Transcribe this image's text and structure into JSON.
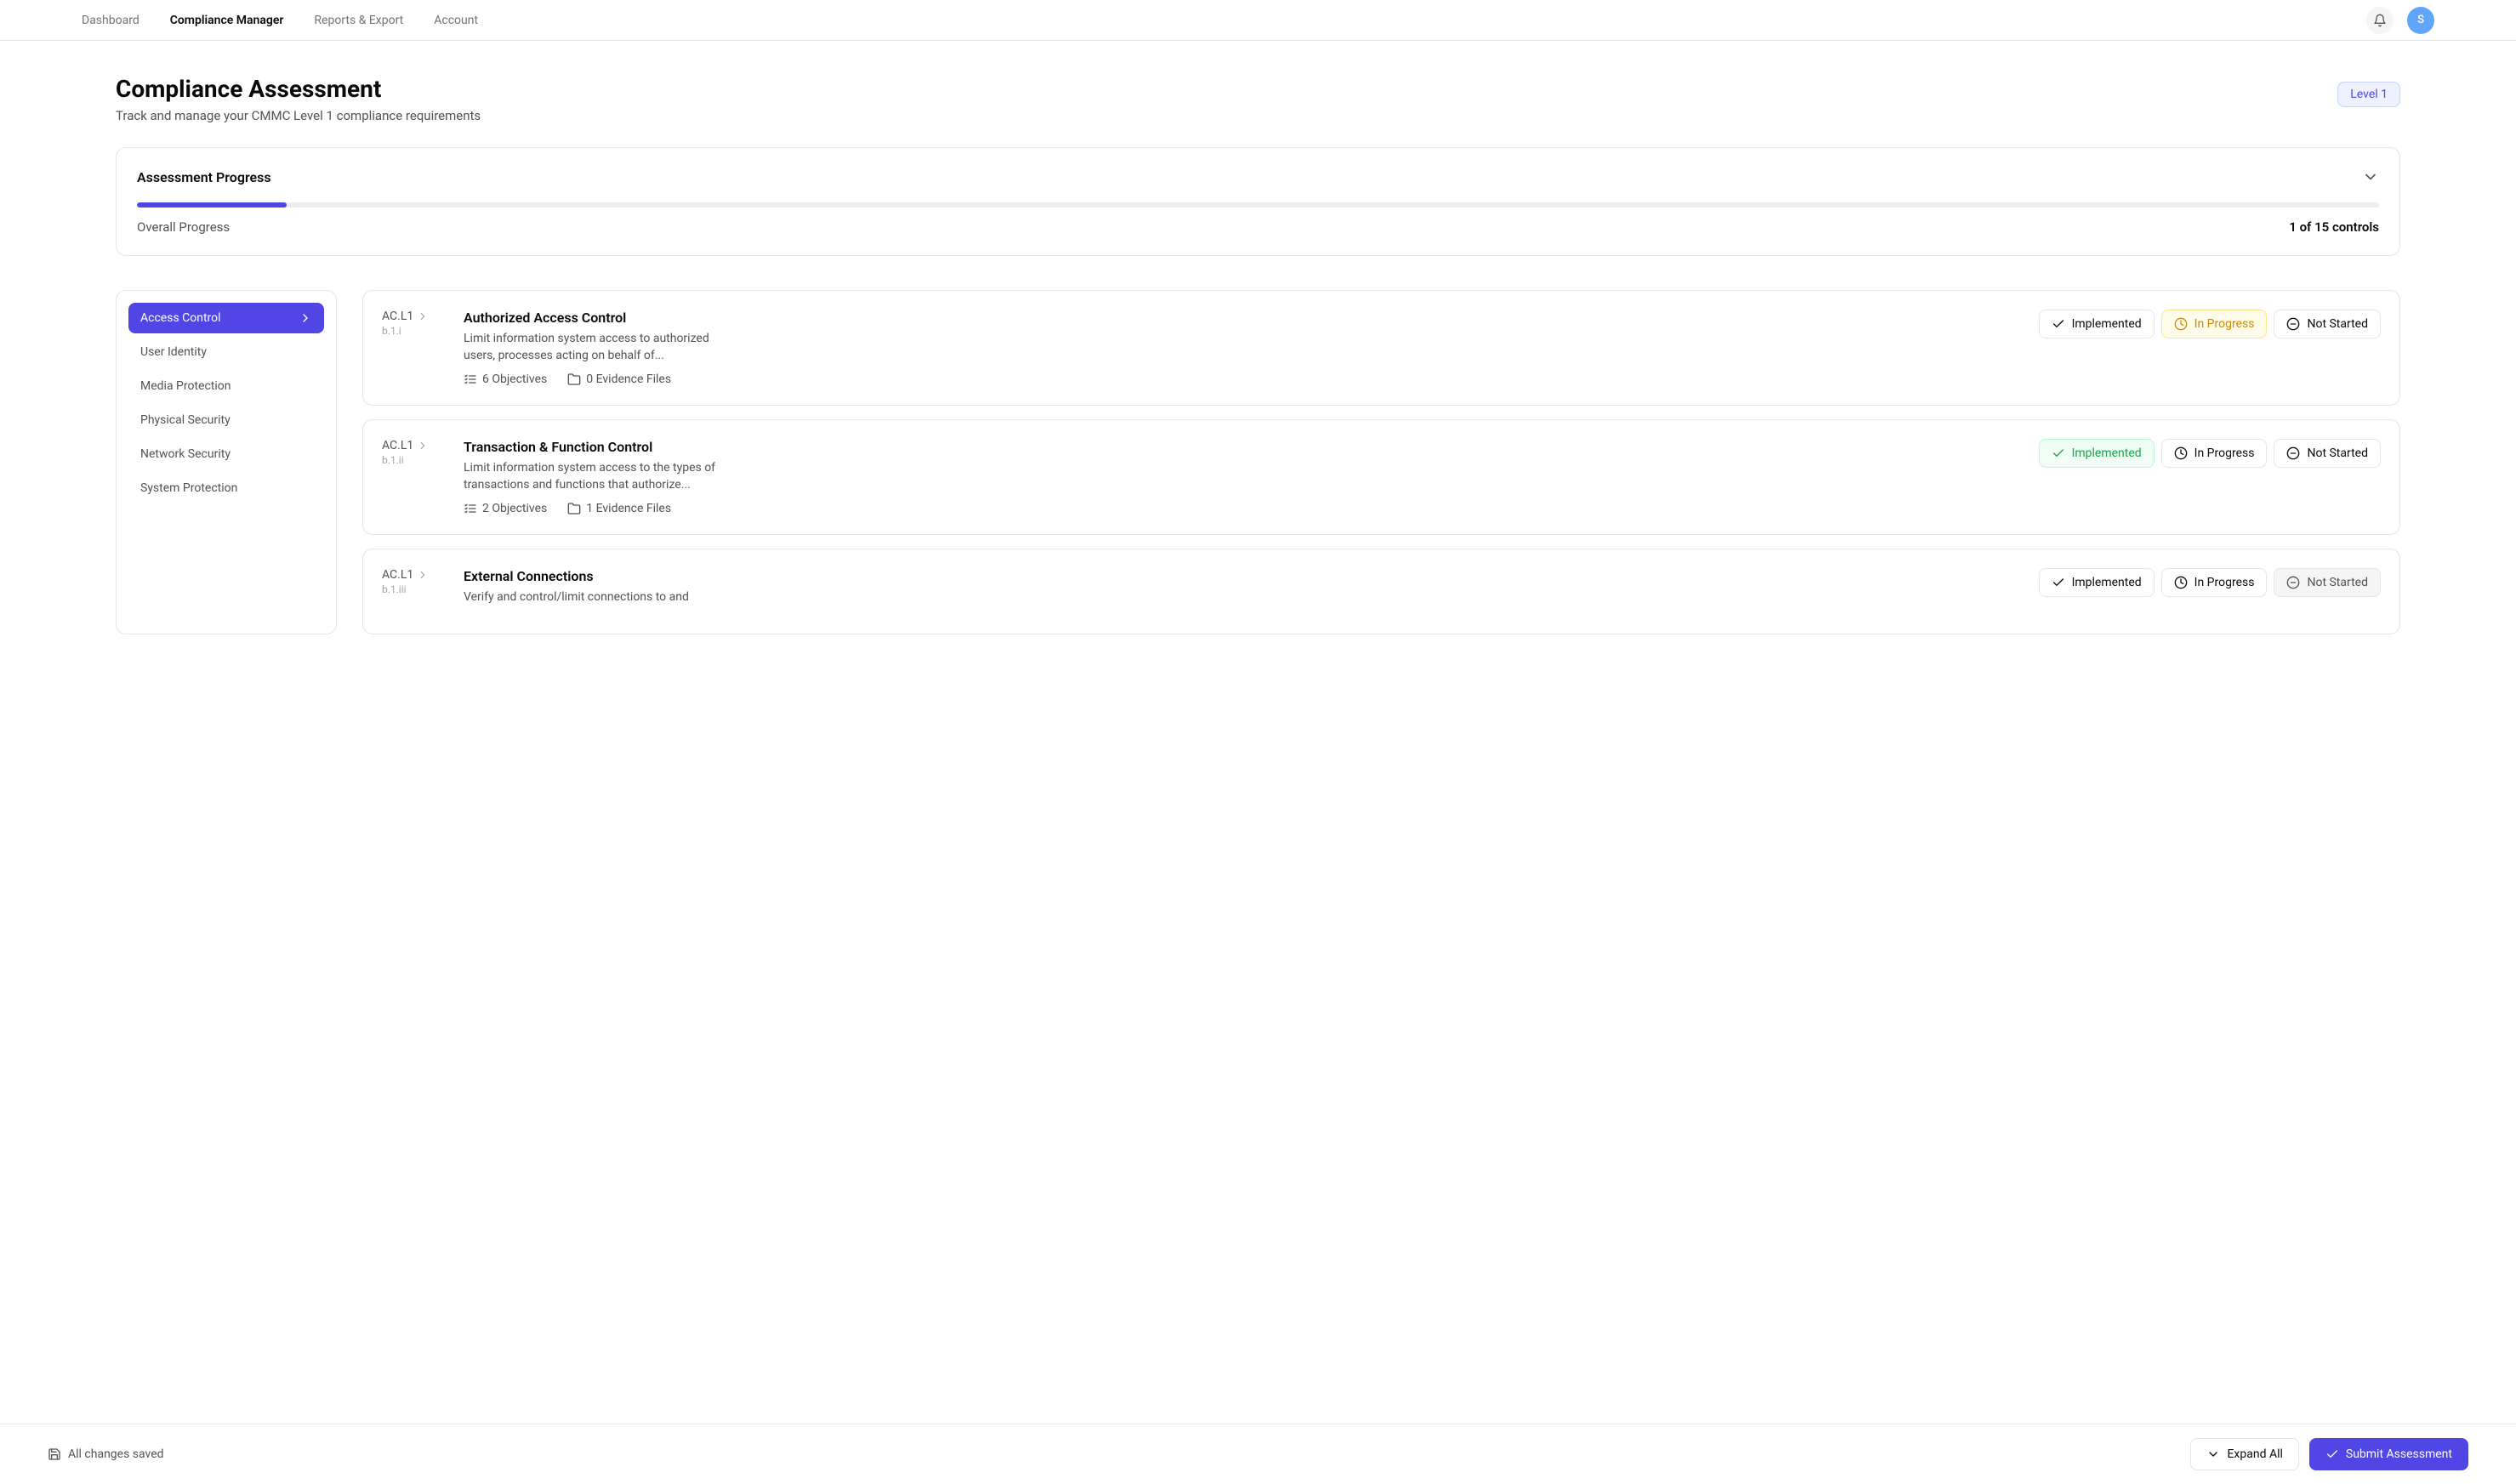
{
  "nav": {
    "tabs": [
      "Dashboard",
      "Compliance Manager",
      "Reports & Export",
      "Account"
    ],
    "active_index": 1
  },
  "avatar_initial": "S",
  "page": {
    "title": "Compliance Assessment",
    "subtitle": "Track and manage your CMMC Level 1 compliance requirements",
    "level_badge": "Level 1"
  },
  "progress": {
    "title": "Assessment Progress",
    "label": "Overall Progress",
    "count": "1 of 15 controls",
    "percent": 6.67
  },
  "sidebar": {
    "items": [
      "Access Control",
      "User Identity",
      "Media Protection",
      "Physical Security",
      "Network Security",
      "System Protection"
    ],
    "active_index": 0
  },
  "status_labels": {
    "implemented": "Implemented",
    "in_progress": "In Progress",
    "not_started": "Not Started"
  },
  "controls": [
    {
      "id": "AC.L1",
      "sub": "b.1.i",
      "title": "Authorized Access Control",
      "desc": "Limit information system access to authorized users, processes acting on behalf of...",
      "objectives": "6 Objectives",
      "evidence": "0 Evidence Files",
      "selected": "in_progress"
    },
    {
      "id": "AC.L1",
      "sub": "b.1.ii",
      "title": "Transaction & Function Control",
      "desc": "Limit information system access to the types of transactions and functions that authorize...",
      "objectives": "2 Objectives",
      "evidence": "1 Evidence Files",
      "selected": "implemented"
    },
    {
      "id": "AC.L1",
      "sub": "b.1.iii",
      "title": "External Connections",
      "desc": "Verify and control/limit connections to and",
      "objectives": "",
      "evidence": "",
      "selected": "not_started"
    }
  ],
  "footer": {
    "save_status": "All changes saved",
    "expand": "Expand All",
    "submit": "Submit Assessment"
  }
}
